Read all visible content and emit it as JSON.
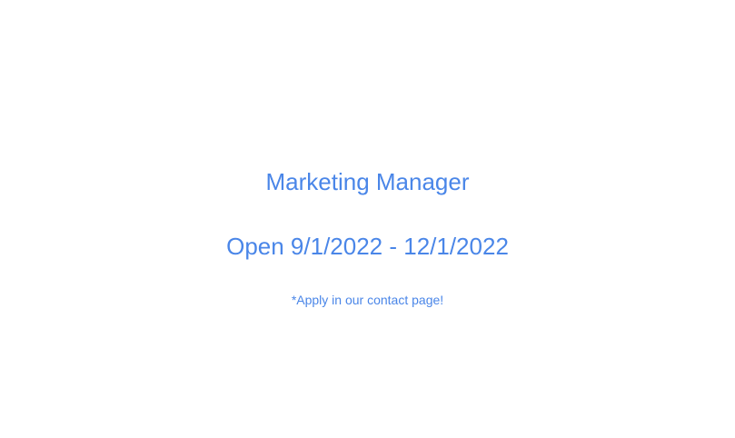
{
  "job": {
    "title": "Marketing Manager",
    "dates": "Open 9/1/2022 - 12/1/2022",
    "note": "*Apply in our contact page!"
  },
  "colors": {
    "text_accent": "#4a86e8",
    "background": "#ffffff"
  }
}
